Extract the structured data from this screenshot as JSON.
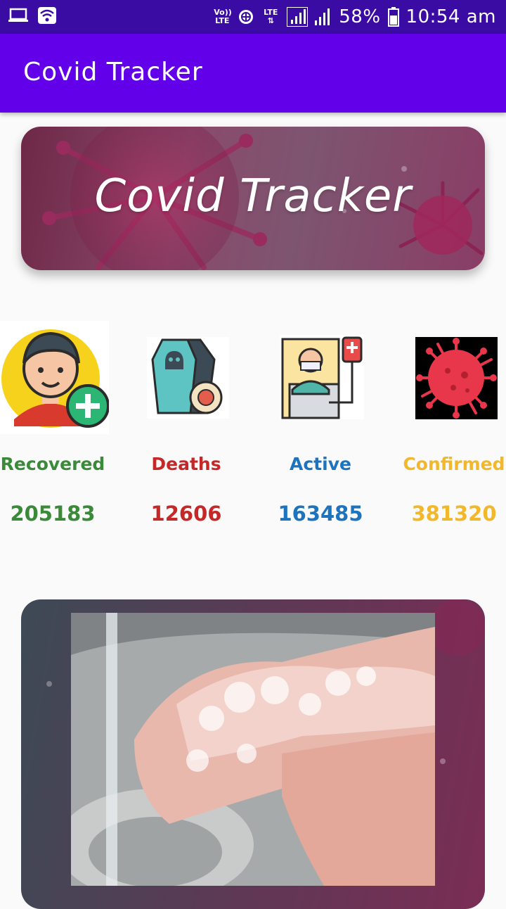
{
  "status_bar": {
    "volte": "Vo)) LTE",
    "lte": "LTE",
    "battery": "58%",
    "time": "10:54 am"
  },
  "app_bar": {
    "title": "Covid Tracker"
  },
  "banner": {
    "title": "Covid Tracker"
  },
  "stats": [
    {
      "label": "Recovered",
      "value": "205183",
      "color": "#3a8a3a",
      "icon": "recovered-person-icon"
    },
    {
      "label": "Deaths",
      "value": "12606",
      "color": "#c62828",
      "icon": "coffin-icon"
    },
    {
      "label": "Active",
      "value": "163485",
      "color": "#1e73be",
      "icon": "hospital-patient-icon"
    },
    {
      "label": "Confirmed",
      "value": "381320",
      "color": "#f2b82b",
      "icon": "virus-icon"
    }
  ],
  "colors": {
    "status_bar": "#3a0ca3",
    "app_bar": "#6200ea"
  }
}
